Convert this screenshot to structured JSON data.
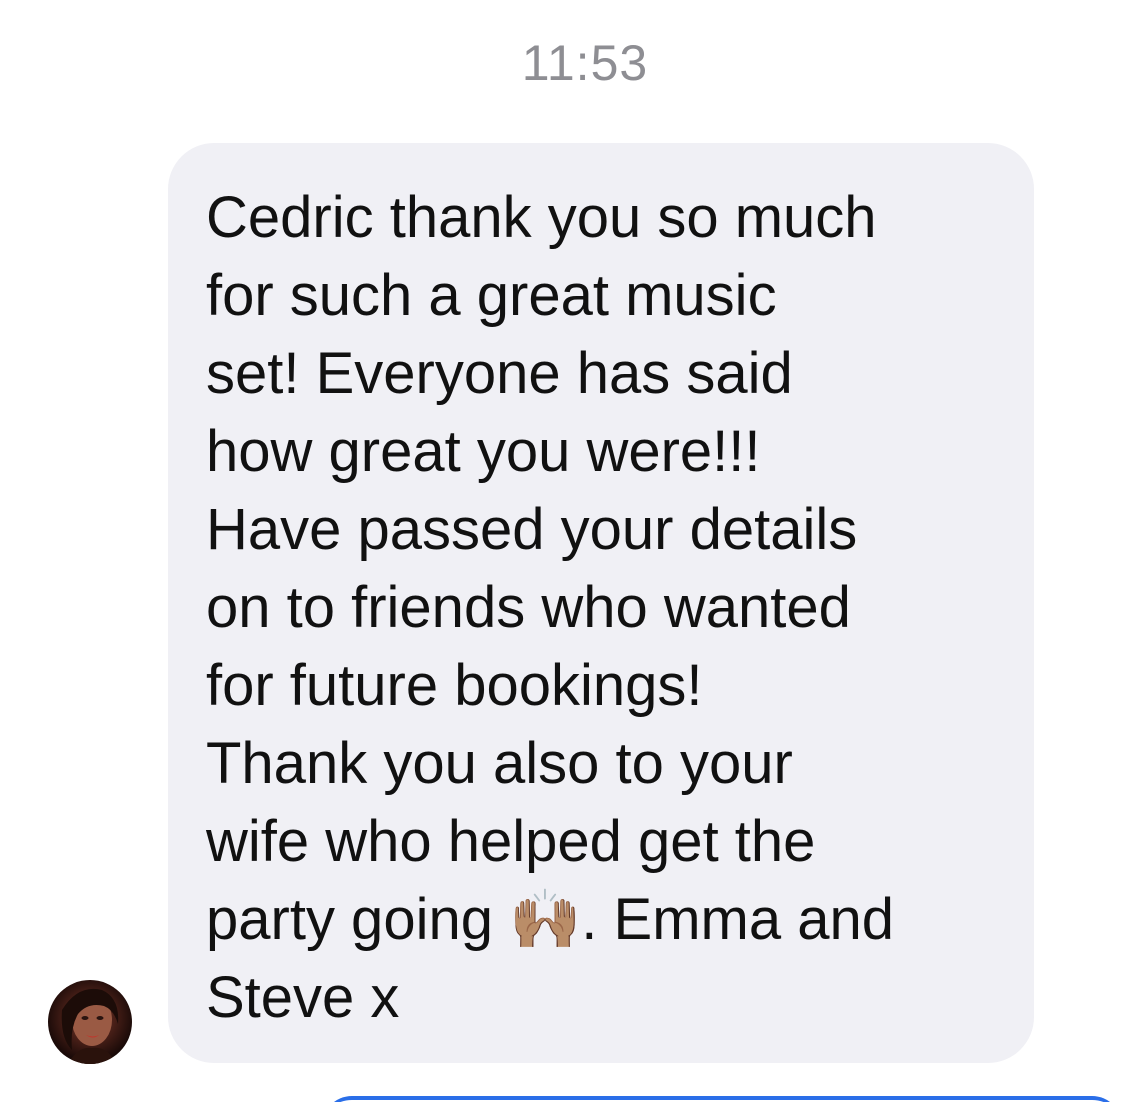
{
  "conversation": {
    "timestamp": "11:53",
    "messages": [
      {
        "direction": "incoming",
        "text": "Cedric thank you so much\nfor such a great music\nset!  Everyone has said\nhow great you were!!!\nHave passed your details\non to friends who wanted\nfor future bookings!\nThank you also to your\nwife who helped get the\nparty going 🙌🏽. Emma and\nSteve x"
      }
    ]
  },
  "icons": {
    "avatar": "sender-avatar-photo"
  },
  "colors": {
    "incoming_bubble": "#f0f0f5",
    "timestamp_text": "#8e8e93",
    "message_text": "#111111",
    "outgoing_accent": "#2a6ee8"
  }
}
